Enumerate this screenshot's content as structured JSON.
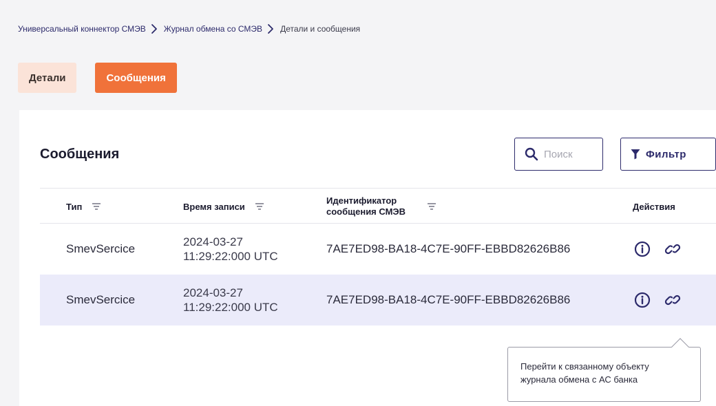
{
  "breadcrumb": {
    "items": [
      "Универсальный коннектор СМЭВ",
      "Журнал обмена со СМЭВ",
      "Детали и сообщения"
    ]
  },
  "tabs": [
    {
      "label": "Детали",
      "active": false
    },
    {
      "label": "Сообщения",
      "active": true
    }
  ],
  "card": {
    "title": "Сообщения",
    "search_placeholder": "Поиск",
    "filter_label": "Фильтр"
  },
  "table": {
    "columns": {
      "type": "Тип",
      "time": "Время записи",
      "id_line1": "Идентификатор",
      "id_line2": "сообщения СМЭВ",
      "actions": "Действия"
    },
    "rows": [
      {
        "type": "SmevSercice",
        "date": "2024-03-27",
        "time": "11:29:22:000 UTC",
        "id": "7AE7ED98-BA18-4C7E-90FF-EBBD82626B86",
        "highlighted": false
      },
      {
        "type": "SmevSercice",
        "date": "2024-03-27",
        "time": "11:29:22:000 UTC",
        "id": "7AE7ED98-BA18-4C7E-90FF-EBBD82626B86",
        "highlighted": true
      }
    ]
  },
  "tooltip": {
    "line1": "Перейти к связанному объекту",
    "line2": "журнала обмена с АС банка"
  },
  "icons": {
    "chevron": "chevron-right-icon",
    "search": "search-icon",
    "filter": "filter-icon",
    "sort": "sort-icon",
    "info": "info-icon",
    "link": "link-icon"
  },
  "colors": {
    "accent": "#f0723a",
    "accent_light": "#fbe3d8",
    "primary": "#2c2a6b",
    "row_highlight": "#ebebfa"
  }
}
